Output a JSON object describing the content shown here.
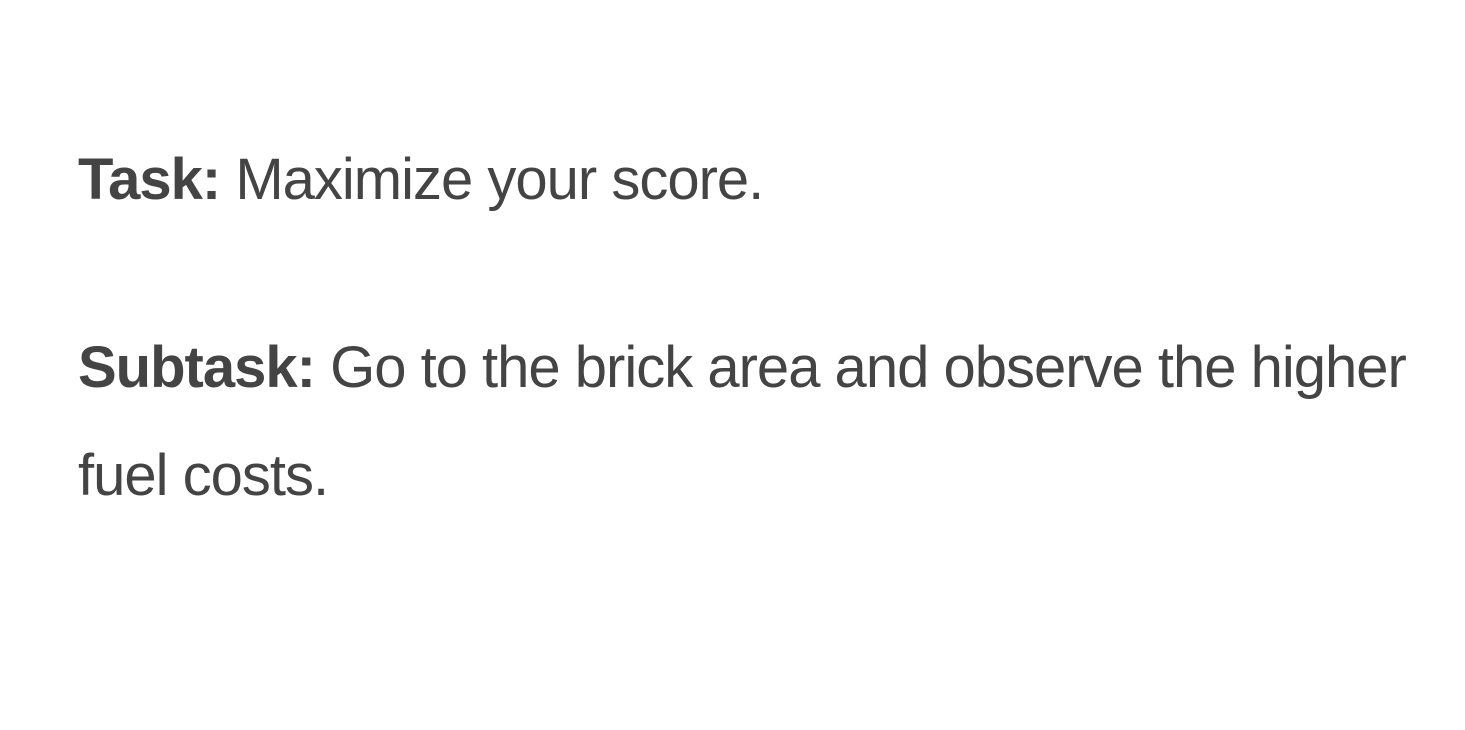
{
  "task": {
    "label": "Task:",
    "text": "Maximize your score."
  },
  "subtask": {
    "label": "Subtask:",
    "text": "Go to the brick area and observe the higher fuel costs."
  }
}
